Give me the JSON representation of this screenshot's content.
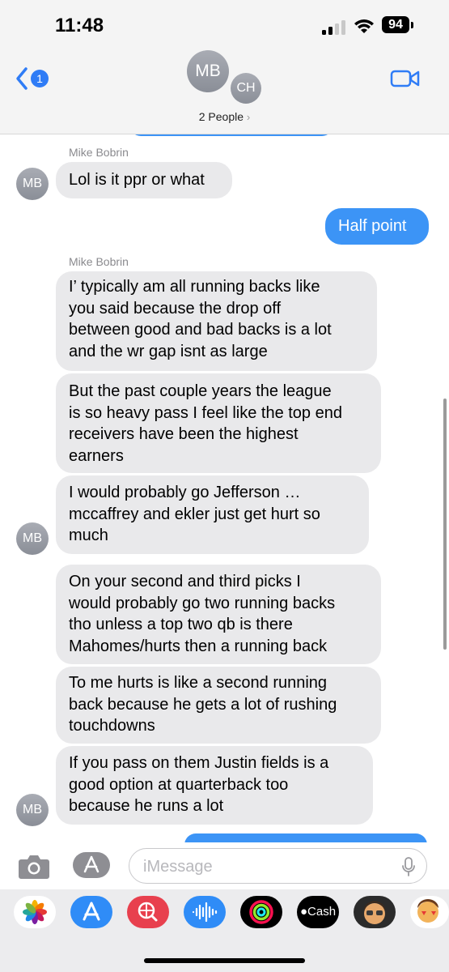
{
  "status_bar": {
    "time": "11:48",
    "battery": "94"
  },
  "header": {
    "back_badge": "1",
    "avatars": [
      "MB",
      "CH"
    ],
    "people_label": "2 People",
    "people_chevron": "›"
  },
  "messages": [
    {
      "sender": "Mike Bobrin"
    },
    {
      "text": "Lol is it ppr or what",
      "avatar": "MB"
    },
    {
      "text": "Half point",
      "outgoing": true
    },
    {
      "sender": "Mike Bobrin"
    },
    {
      "text": "I’ typically am all running backs like\nyou said because the drop off\nbetween good and bad backs is a lot\nand the wr gap isnt as large"
    },
    {
      "text": "But the past couple years the league\nis so heavy pass I feel like the top end\nreceivers have been the highest\nearners"
    },
    {
      "text": "I would probably go Jefferson …\nmccaffrey and ekler just get hurt so\nmuch",
      "avatar": "MB"
    },
    {
      "text": "On your second and third picks I\nwould probably go two running backs\ntho unless a top two qb is there\nMahomes/hurts then a running back"
    },
    {
      "text": "To me hurts is like a second running\nback because he gets a lot of rushing\ntouchdowns"
    },
    {
      "text": "If you pass on them Justin fields is a\ngood option at quarterback too\nbecause he runs a lot",
      "avatar": "MB"
    }
  ],
  "compose": {
    "placeholder": "iMessage"
  },
  "app_drawer": {
    "apps": [
      {
        "name": "photos-app-icon"
      },
      {
        "name": "app-store-app-icon"
      },
      {
        "name": "search-images-app-icon"
      },
      {
        "name": "audio-message-app-icon"
      },
      {
        "name": "fitness-app-icon"
      },
      {
        "name": "apple-cash-app-icon",
        "label": "Cash"
      },
      {
        "name": "memoji-app-icon"
      },
      {
        "name": "stickers-app-icon"
      }
    ]
  },
  "colors": {
    "outgoing_bubble": "#3c94f6",
    "incoming_bubble": "#e9e9eb",
    "accent": "#2f7cf6"
  }
}
